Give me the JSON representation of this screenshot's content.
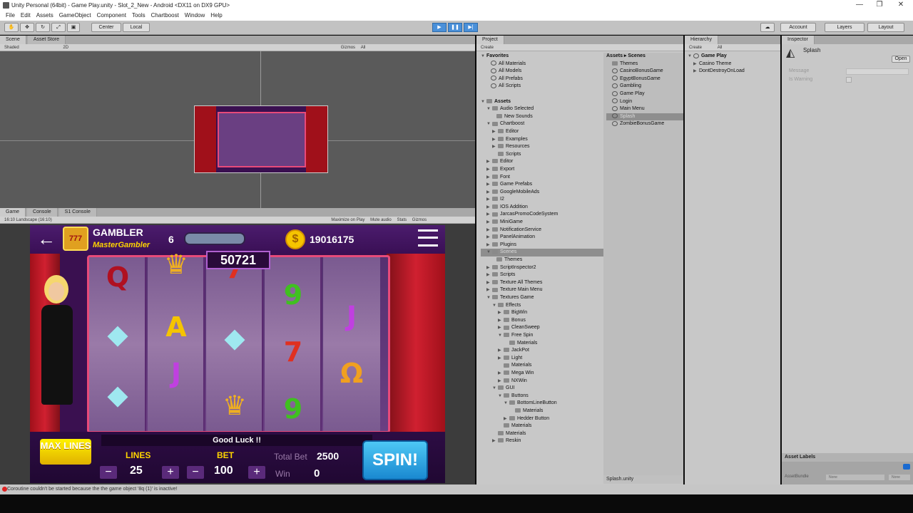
{
  "window": {
    "title": "Unity Personal (64bit) - Game Play.unity - Slot_2_New - Android <DX11 on DX9 GPU>"
  },
  "menu": [
    "File",
    "Edit",
    "Assets",
    "GameObject",
    "Component",
    "Tools",
    "Chartboost",
    "Window",
    "Help"
  ],
  "toolbar": {
    "pivot": "Center",
    "space": "Local",
    "account": "Account",
    "layers": "Layers",
    "layout": "Layout"
  },
  "scene": {
    "tabs": [
      "Scene",
      "Asset Store"
    ],
    "shading": "Shaded",
    "mode2d": "2D",
    "gizmos": "Gizmos",
    "search": "All"
  },
  "game_panel": {
    "tabs": [
      "Game",
      "Console",
      "S1 Console"
    ],
    "aspect": "16:10 Landscape (16:10)",
    "options": [
      "Maximize on Play",
      "Mute audio",
      "Stats",
      "Gizmos"
    ]
  },
  "game": {
    "player_name": "GAMBLER",
    "player_title": "MasterGambler",
    "level": "6",
    "coins": "19016175",
    "jackpot": "50721",
    "message": "Good Luck !!",
    "max_lines": "MAX LINES",
    "lines_label": "LINES",
    "lines_value": "25",
    "bet_label": "BET",
    "bet_value": "100",
    "total_bet_label": "Total Bet",
    "total_bet_value": "2500",
    "win_label": "Win",
    "win_value": "0",
    "spin": "SPIN!",
    "reels": [
      [
        "Q",
        "◆",
        "◆"
      ],
      [
        "♛",
        "A",
        "J"
      ],
      [
        "7",
        "◆",
        "♛"
      ],
      [
        "9",
        "7",
        "9"
      ],
      [
        "",
        "J",
        "Ω"
      ]
    ]
  },
  "project": {
    "tab": "Project",
    "create": "Create",
    "favorites": {
      "label": "Favorites",
      "items": [
        "All Materials",
        "All Models",
        "All Prefabs",
        "All Scripts"
      ]
    },
    "assets_label": "Assets",
    "tree": [
      "Audio Selected",
      "New Sounds",
      "Chartboost",
      "Editor",
      "Examples",
      "Resources",
      "Scripts",
      "Editor",
      "Export",
      "Font",
      "Game Prefabs",
      "GoogleMobileAds",
      "I2",
      "IOS Addition",
      "JarcasPromoCodeSystem",
      "MiniGame",
      "NotificationService",
      "PanelAnimation",
      "Plugins",
      "Scenes",
      "Themes",
      "ScriptInspector2",
      "Scripts",
      "Texture All Themes",
      "Texture Main Menu",
      "Textures Game",
      "Effects",
      "BigWin",
      "Bonus",
      "CleanSweep",
      "Free Spin",
      "Materials",
      "JackPot",
      "Light",
      "Materials",
      "Mega Win",
      "NXWin",
      "GUI",
      "Buttons",
      "BottomLineButton",
      "Materials",
      "Hedder Button",
      "Materials",
      "Materials",
      "Reskin"
    ],
    "breadcrumb": [
      "Assets",
      "Scenes"
    ],
    "scenes": [
      "Themes",
      "CasinoBonusGame",
      "EgyptBonusGame",
      "Gambling",
      "Game Play",
      "Login",
      "Main Menu",
      "Splash",
      "ZombieBonusGame"
    ],
    "footer": "Splash.unity"
  },
  "hierarchy": {
    "tab": "Hierarchy",
    "create": "Create",
    "search": "All",
    "root": "Game Play",
    "items": [
      "Casino Theme",
      "DontDestroyOnLoad"
    ]
  },
  "inspector": {
    "tab": "Inspector",
    "object": "Splash",
    "open": "Open",
    "fields": [
      "Message",
      "Is Warning"
    ],
    "labels": "Asset Labels",
    "bundle": "AssetBundle",
    "none1": "None",
    "none2": "None"
  },
  "status": {
    "message": "Coroutine couldn't be started because the the game object '8q (1)' is inactive!"
  },
  "colors": {
    "editor_bg": "#c8c8c8",
    "play_accent": "#4a90d9",
    "game_purple": "#3a1050",
    "gold": "#ffd400",
    "spin_blue": "#1aa3e8"
  }
}
